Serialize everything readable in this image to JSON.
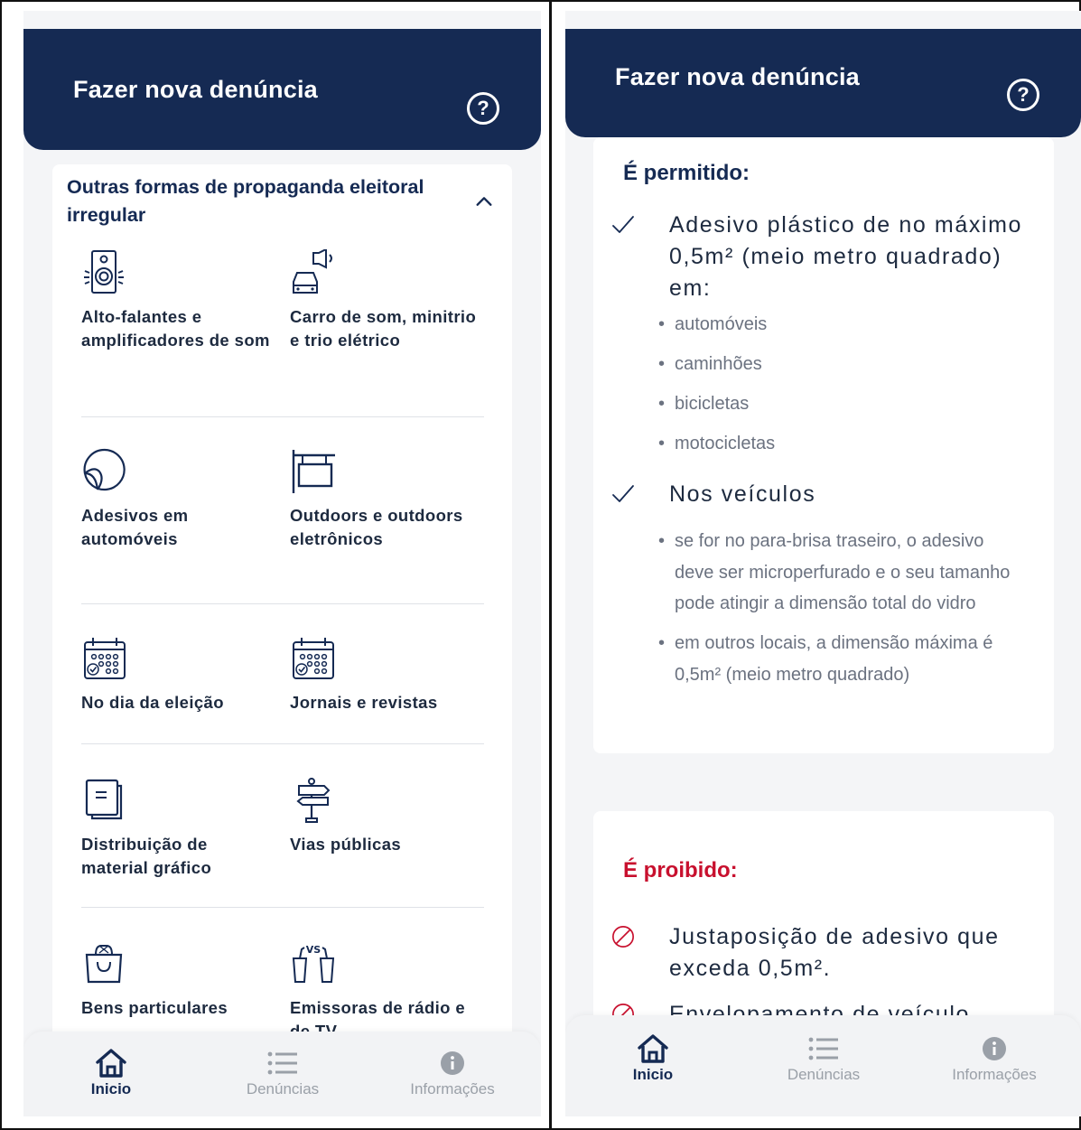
{
  "left_panel": {
    "header_title": "Fazer nova denúncia",
    "help_icon": "?",
    "accordion_title": "Outras formas de propaganda eleitoral irregular",
    "categories": [
      {
        "label": "Alto-falantes e amplificadores de som",
        "icon": "speaker-icon"
      },
      {
        "label": "Carro de som, minitrio e trio elétrico",
        "icon": "sound-car-icon"
      },
      {
        "label": "Adesivos em automóveis",
        "icon": "sticker-icon"
      },
      {
        "label": "Outdoors e outdoors eletrônicos",
        "icon": "billboard-icon"
      },
      {
        "label": "No dia da eleição",
        "icon": "calendar-icon"
      },
      {
        "label": "Jornais e revistas",
        "icon": "calendar-icon"
      },
      {
        "label": "Distribuição de material gráfico",
        "icon": "document-icon"
      },
      {
        "label": "Vias públicas",
        "icon": "signpost-icon"
      },
      {
        "label": "Bens particulares",
        "icon": "shopping-bag-icon"
      },
      {
        "label": "Emissoras de rádio e de TV",
        "icon": "versus-icon"
      }
    ],
    "nav": {
      "home": "Inicio",
      "reports": "Denúncias",
      "info": "Informações"
    }
  },
  "right_panel": {
    "header_title": "Fazer nova denúncia",
    "help_icon": "?",
    "allowed": {
      "heading": "É permitido:",
      "rule1": "Adesivo plástico de no máximo 0,5m² (meio metro quadrado) em:",
      "rule1_bullets": [
        "automóveis",
        "caminhões",
        "bicicletas",
        "motocicletas"
      ],
      "rule2": "Nos veículos",
      "rule2_bullets": [
        "se for no para-brisa traseiro, o adesivo deve ser microperfurado e o seu tamanho pode atingir a dimensão total do vidro",
        "em outros locais, a dimensão máxima é 0,5m² (meio metro quadrado)"
      ]
    },
    "forbidden": {
      "heading": "É proibido:",
      "rule1": "Justaposição de adesivo que exceda 0,5m².",
      "rule2": "Envelopamento de veículo."
    },
    "nav": {
      "home": "Inicio",
      "reports": "Denúncias",
      "info": "Informações"
    }
  },
  "colors": {
    "navy": "#152a53",
    "red": "#c8102e",
    "gray_text": "#6b7280",
    "nav_inactive": "#9aa0a8"
  }
}
